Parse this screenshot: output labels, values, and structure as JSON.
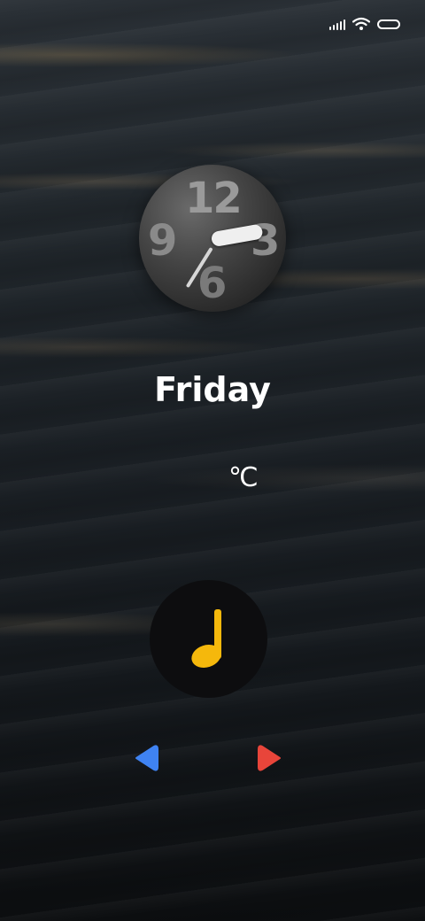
{
  "status_bar": {
    "signal_icon": "cell-signal-icon",
    "wifi_icon": "wifi-icon",
    "battery_icon": "battery-icon"
  },
  "clock": {
    "numerals": {
      "twelve": "12",
      "three": "3",
      "six": "6",
      "nine": "9"
    }
  },
  "day_label": "Friday",
  "weather": {
    "temperature": "℃"
  },
  "music": {
    "icon": "music-note-icon",
    "icon_color": "#f5b80c"
  },
  "navigation": {
    "prev_icon": "left-triangle-icon",
    "prev_color": "#3f83f2",
    "next_icon": "right-triangle-icon",
    "next_color": "#e8453a"
  }
}
